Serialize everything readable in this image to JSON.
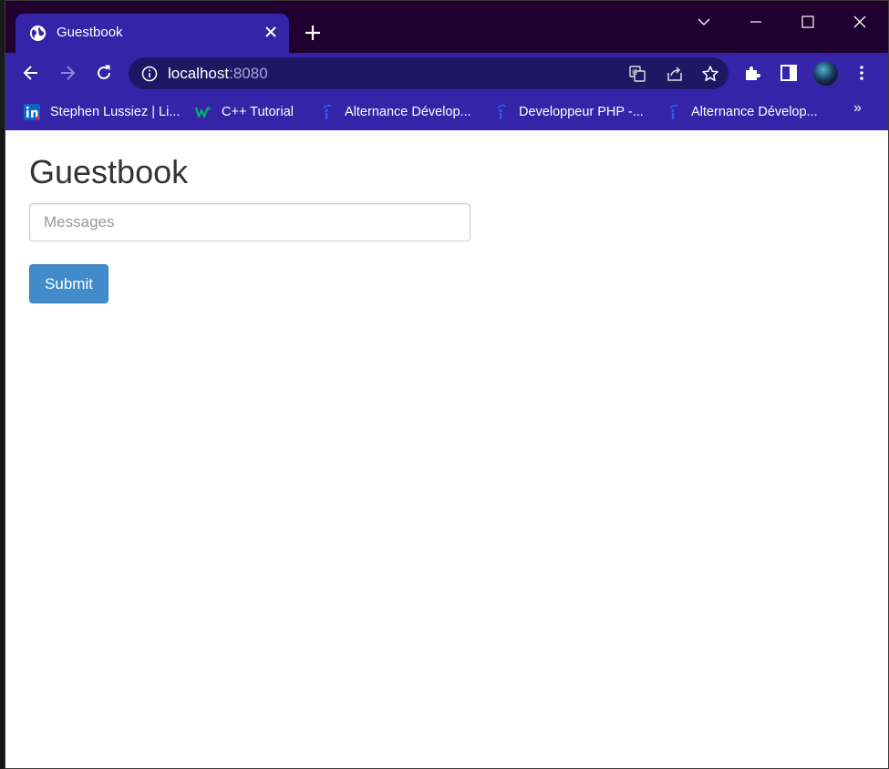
{
  "tab": {
    "title": "Guestbook",
    "close_icon": "close-icon",
    "favicon": "globe-icon"
  },
  "omnibox": {
    "host": "localhost",
    "port": ":8080"
  },
  "bookmarks": [
    {
      "label": "Stephen Lussiez | Li...",
      "icon": "linkedin-icon"
    },
    {
      "label": "C++ Tutorial",
      "icon": "w3schools-icon"
    },
    {
      "label": "Alternance Dévelop...",
      "icon": "indeed-icon"
    },
    {
      "label": "Developpeur PHP -...",
      "icon": "indeed-icon"
    },
    {
      "label": "Alternance Dévelop...",
      "icon": "indeed-icon"
    }
  ],
  "bookmarks_overflow": "»",
  "page": {
    "title": "Guestbook",
    "input_placeholder": "Messages",
    "submit_label": "Submit"
  },
  "colors": {
    "browser_frame": "#3523a8",
    "title_bar": "#20002e",
    "omnibox": "#1f1764",
    "button_primary": "#428bca"
  }
}
